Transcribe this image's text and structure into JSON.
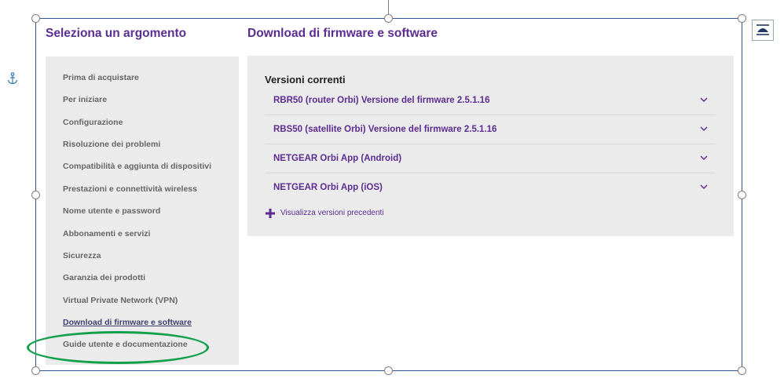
{
  "sidebar": {
    "heading": "Seleziona un argomento",
    "items": [
      "Prima di acquistare",
      "Per iniziare",
      "Configurazione",
      "Risoluzione dei problemi",
      "Compatibilità e aggiunta di dispositivi",
      "Prestazioni e connettività wireless",
      "Nome utente e password",
      "Abbonamenti e servizi",
      "Sicurezza",
      "Garanzia dei prodotti",
      "Virtual Private Network (VPN)",
      "Download di firmware e software",
      "Guide utente e documentazione"
    ],
    "active_item": "Download di firmware e software"
  },
  "main": {
    "heading": "Download di firmware e software",
    "section_title": "Versioni correnti",
    "accordion": [
      "RBR50 (router Orbi) Versione del firmware 2.5.1.16",
      "RBS50 (satellite Orbi) Versione del firmware 2.5.1.16",
      "NETGEAR Orbi App (Android)",
      "NETGEAR Orbi App (iOS)"
    ],
    "more_link": "Visualizza versioni precedenti"
  },
  "icons": {
    "anchor": "anchor-icon",
    "layout_options": "layout-options-icon",
    "chevron": "chevron-down-icon",
    "plus": "plus-icon"
  },
  "colors": {
    "accent": "#5c2d91",
    "panel_bg": "#ebebeb",
    "frame": "#2f5597",
    "annotation": "#12a14a"
  }
}
